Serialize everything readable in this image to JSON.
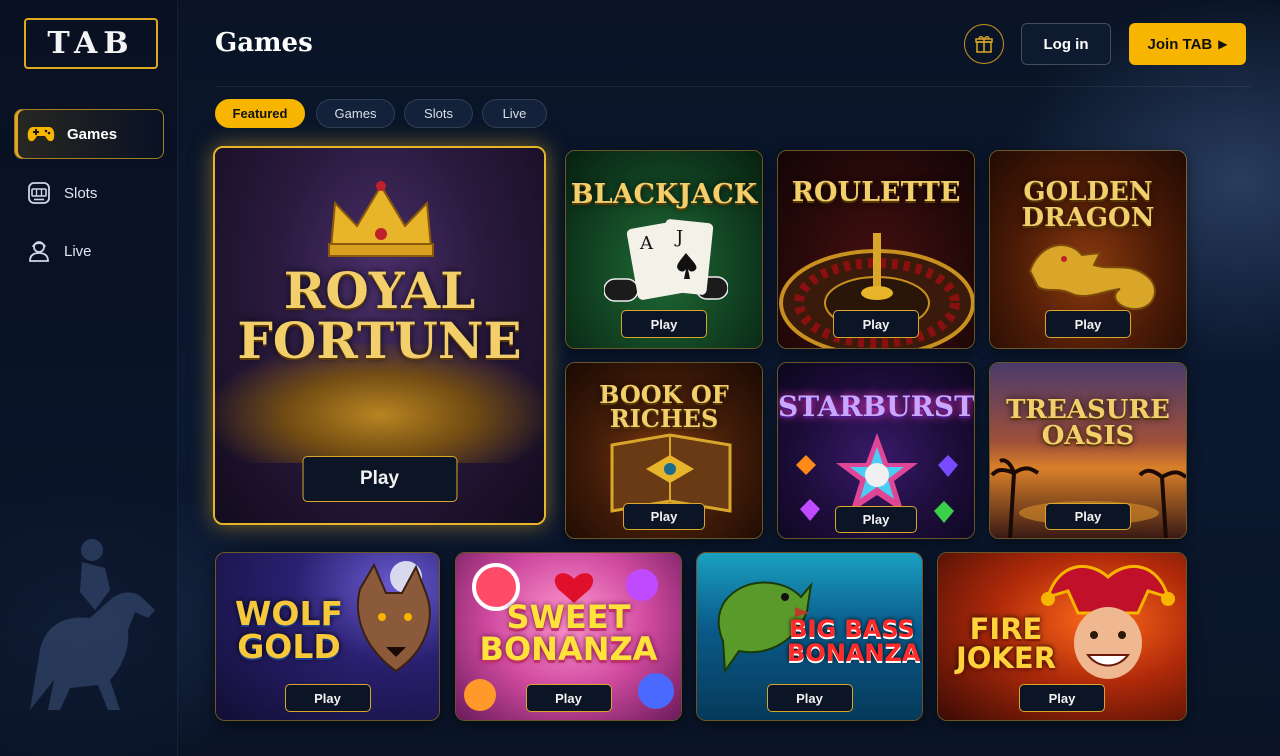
{
  "brand": {
    "logo_text": "TAB"
  },
  "colors": {
    "accent": "#f7b500",
    "gold_border": "#e0a722",
    "background": "#0a1426"
  },
  "sidebar": {
    "items": [
      {
        "label": "Games",
        "icon": "gamepad-icon",
        "active": true
      },
      {
        "label": "Slots",
        "icon": "slot-machine-icon",
        "active": false
      },
      {
        "label": "Live",
        "icon": "live-dealer-icon",
        "active": false
      }
    ]
  },
  "header": {
    "title": "Games",
    "gift_icon": "gift-icon",
    "login_label": "Log in",
    "join_label": "Join TAB",
    "join_icon": "play-arrow-icon"
  },
  "tabs": [
    {
      "label": "Featured",
      "active": true
    },
    {
      "label": "Games",
      "active": false
    },
    {
      "label": "Slots",
      "active": false
    },
    {
      "label": "Live",
      "active": false
    }
  ],
  "games": {
    "featured": {
      "title": "ROYAL\nFORTUNE",
      "play_label": "Play"
    },
    "row1": [
      {
        "title": "BLACKJACK",
        "play_label": "Play"
      },
      {
        "title": "ROULETTE",
        "play_label": "Play"
      },
      {
        "title": "GOLDEN\nDRAGON",
        "play_label": "Play"
      }
    ],
    "row2": [
      {
        "title": "BOOK OF\nRICHES",
        "play_label": "Play"
      },
      {
        "title": "STARBURST",
        "play_label": "Play"
      },
      {
        "title": "TREASURE\nOASIS",
        "play_label": "Play"
      }
    ],
    "row3": [
      {
        "title": "WOLF\nGOLD",
        "play_label": "Play"
      },
      {
        "title": "SWEET\nBONANZA",
        "play_label": "Play"
      },
      {
        "title": "BIG BASS\nBONANZA",
        "play_label": "Play"
      },
      {
        "title": "FIRE\nJOKER",
        "play_label": "Play"
      }
    ]
  }
}
